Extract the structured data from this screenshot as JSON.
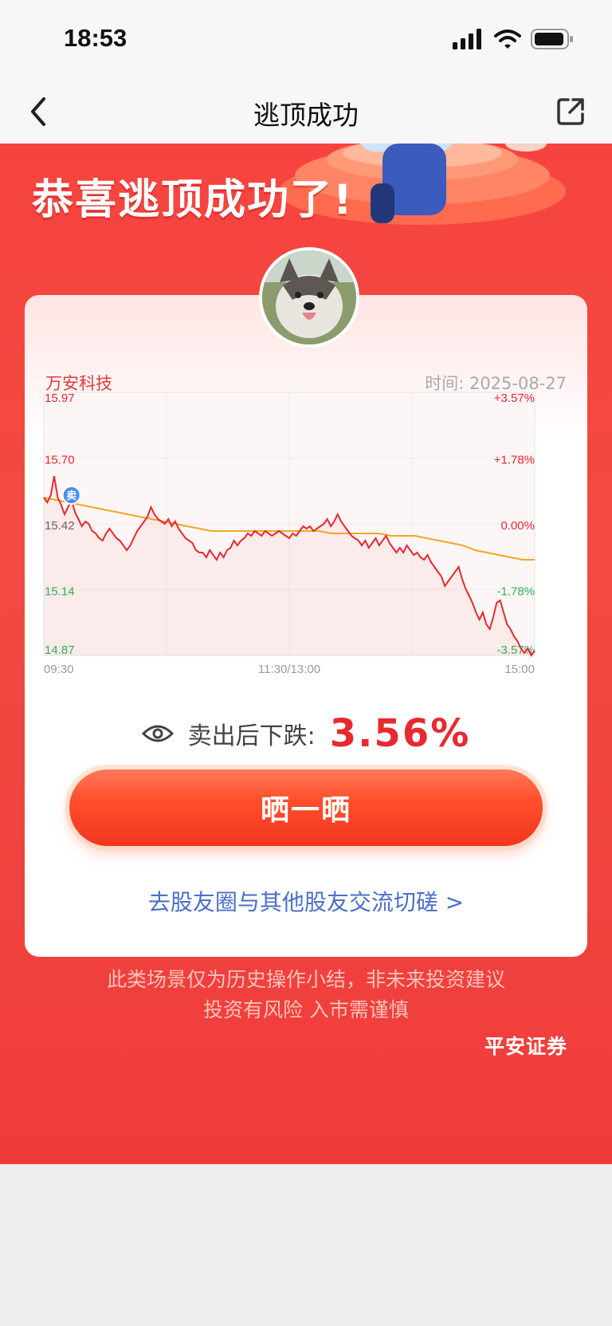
{
  "status_bar": {
    "time": "18:53"
  },
  "nav": {
    "title": "逃顶成功"
  },
  "hero": {
    "title": "恭喜逃顶成功了!"
  },
  "card": {
    "stock_name": "万安科技",
    "time_label": "时间: 2025-08-27",
    "result_label": "卖出后下跌:",
    "result_value": "3.56%",
    "share_button": "晒一晒",
    "link_text": "去股友圈与其他股友交流切磋 >"
  },
  "chart_data": {
    "type": "line",
    "title": "",
    "price_ticks": [
      "15.97",
      "15.70",
      "15.42",
      "15.14",
      "14.87"
    ],
    "percent_ticks": [
      "+3.57%",
      "+1.78%",
      "0.00%",
      "-1.78%",
      "-3.57%"
    ],
    "x_ticks": [
      "09:30",
      "11:30/13:00",
      "15:00"
    ],
    "ylim": [
      14.87,
      15.97
    ],
    "sell_marker": {
      "label": "卖",
      "time_index": 8,
      "price": 15.52
    },
    "series": [
      {
        "values": [
          15.53,
          15.51,
          15.54,
          15.62,
          15.53,
          15.5,
          15.46,
          15.49,
          15.52,
          15.47,
          15.44,
          15.41,
          15.43,
          15.42,
          15.39,
          15.38,
          15.36,
          15.35,
          15.38,
          15.4,
          15.38,
          15.36,
          15.35,
          15.33,
          15.31,
          15.33,
          15.36,
          15.39,
          15.41,
          15.43,
          15.45,
          15.49,
          15.46,
          15.44,
          15.43,
          15.42,
          15.44,
          15.41,
          15.43,
          15.4,
          15.38,
          15.36,
          15.35,
          15.34,
          15.31,
          15.3,
          15.3,
          15.28,
          15.31,
          15.29,
          15.27,
          15.3,
          15.28,
          15.31,
          15.32,
          15.35,
          15.33,
          15.35,
          15.36,
          15.38,
          15.37,
          15.39,
          15.38,
          15.37,
          15.39,
          15.38,
          15.37,
          15.38,
          15.39,
          15.38,
          15.37,
          15.36,
          15.38,
          15.37,
          15.39,
          15.41,
          15.4,
          15.41,
          15.39,
          15.4,
          15.41,
          15.42,
          15.44,
          15.41,
          15.43,
          15.46,
          15.43,
          15.41,
          15.39,
          15.37,
          15.36,
          15.35,
          15.33,
          15.35,
          15.32,
          15.34,
          15.36,
          15.33,
          15.35,
          15.37,
          15.34,
          15.32,
          15.3,
          15.32,
          15.3,
          15.33,
          15.31,
          15.29,
          15.3,
          15.28,
          15.27,
          15.29,
          15.26,
          15.24,
          15.22,
          15.2,
          15.16,
          15.18,
          15.2,
          15.22,
          15.24,
          15.19,
          15.15,
          15.12,
          15.09,
          15.05,
          15.02,
          15.05,
          15.0,
          14.98,
          15.03,
          15.09,
          15.1,
          15.05,
          15.0,
          14.98,
          14.95,
          14.93,
          14.9,
          14.88,
          14.9,
          14.87,
          14.89
        ],
        "color": "#e8292f"
      },
      {
        "values": [
          15.53,
          15.52,
          15.51,
          15.5,
          15.49,
          15.48,
          15.47,
          15.46,
          15.45,
          15.44,
          15.43,
          15.42,
          15.41,
          15.4,
          15.39,
          15.39,
          15.39,
          15.39,
          15.39,
          15.39,
          15.39,
          15.39,
          15.39,
          15.39,
          15.38,
          15.38,
          15.38,
          15.38,
          15.38,
          15.37,
          15.37,
          15.37,
          15.36,
          15.35,
          15.34,
          15.33,
          15.31,
          15.3,
          15.29,
          15.28,
          15.27,
          15.27
        ],
        "color": "#f5a623"
      }
    ]
  },
  "footer": {
    "disclaimer_line1": "此类场景仅为历史操作小结，非未来投资建议",
    "disclaimer_line2": "投资有风险 入市需谨慎",
    "brand": "平安证券"
  },
  "colors": {
    "accent_red": "#e8292f",
    "hero_red": "#f24a41",
    "link_blue": "#4a6fc9",
    "avg_line": "#f5a623",
    "down_green": "#2db45a"
  }
}
